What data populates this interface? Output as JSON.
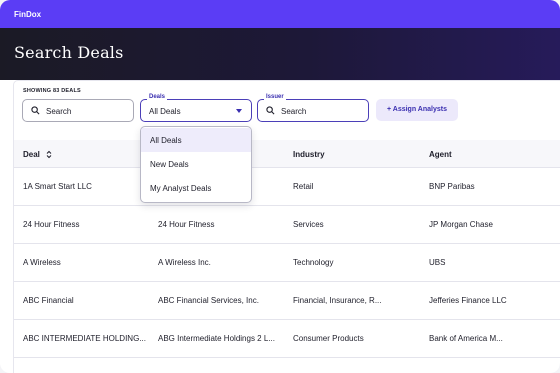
{
  "app": {
    "brand": "FinDox"
  },
  "page": {
    "title": "Search Deals"
  },
  "filters": {
    "showing": "SHOWING 83 DEALS",
    "search": {
      "placeholder": "Search"
    },
    "deals": {
      "label": "Deals",
      "value": "All Deals",
      "options": [
        "All Deals",
        "New Deals",
        "My Analyst Deals"
      ],
      "selected": 0
    },
    "issuer": {
      "label": "Issuer",
      "placeholder": "Search"
    },
    "assign_button": "+ Assign Analysts"
  },
  "table": {
    "columns": [
      "Deal",
      "",
      "Industry",
      "Agent"
    ],
    "rows": [
      [
        "1A Smart Start LLC",
        "",
        "Retail",
        "BNP Paribas"
      ],
      [
        "24 Hour Fitness",
        "24 Hour Fitness",
        "Services",
        "JP Morgan Chase"
      ],
      [
        "A Wireless",
        "A Wireless Inc.",
        "Technology",
        "UBS"
      ],
      [
        "ABC Financial",
        "ABC Financial Services, Inc.",
        "Financial, Insurance, R...",
        "Jefferies Finance LLC"
      ],
      [
        "ABC INTERMEDIATE HOLDING...",
        "ABG Intermediate Holdings 2 L...",
        "Consumer Products",
        "Bank of America M..."
      ]
    ]
  },
  "colors": {
    "brand": "#5b3df5",
    "accent": "#3a2fb0",
    "hero_dark": "#1b1a25"
  },
  "icons": {
    "search": "search-icon",
    "sort": "sort-icon",
    "caret": "chevron-down-icon"
  }
}
